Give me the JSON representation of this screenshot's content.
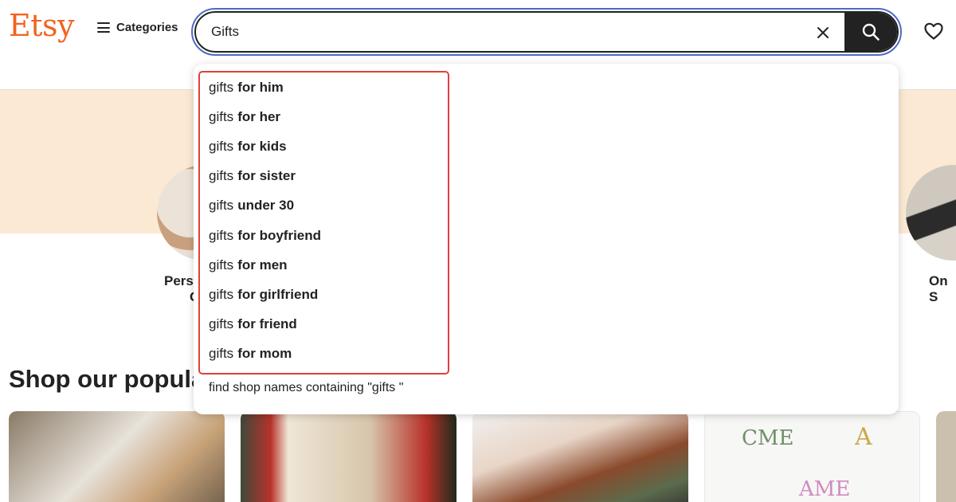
{
  "header": {
    "logo": "Etsy",
    "categories_label": "Categories",
    "search": {
      "value": "Gifts"
    }
  },
  "dropdown": {
    "suggestions": [
      {
        "query": "gifts",
        "completion": "for him"
      },
      {
        "query": "gifts",
        "completion": "for her"
      },
      {
        "query": "gifts",
        "completion": "for kids"
      },
      {
        "query": "gifts",
        "completion": "for sister"
      },
      {
        "query": "gifts",
        "completion": "under 30"
      },
      {
        "query": "gifts",
        "completion": "for boyfriend"
      },
      {
        "query": "gifts",
        "completion": "for men"
      },
      {
        "query": "gifts",
        "completion": "for girlfriend"
      },
      {
        "query": "gifts",
        "completion": "for friend"
      },
      {
        "query": "gifts",
        "completion": "for mom"
      }
    ],
    "shop_names_label": "find shop names containing \"gifts \""
  },
  "page": {
    "circle_left_label_line1": "Pers",
    "circle_left_label_line2": "G",
    "circle_right_label": "On S",
    "section_title": "Shop our popula"
  },
  "colors": {
    "brand": "#f1641e",
    "hero_band": "#fbe9d4",
    "search_focus": "#4d6bc6",
    "highlight": "#e0403a"
  },
  "card_monograms": [
    "CME",
    "A",
    "AME"
  ]
}
